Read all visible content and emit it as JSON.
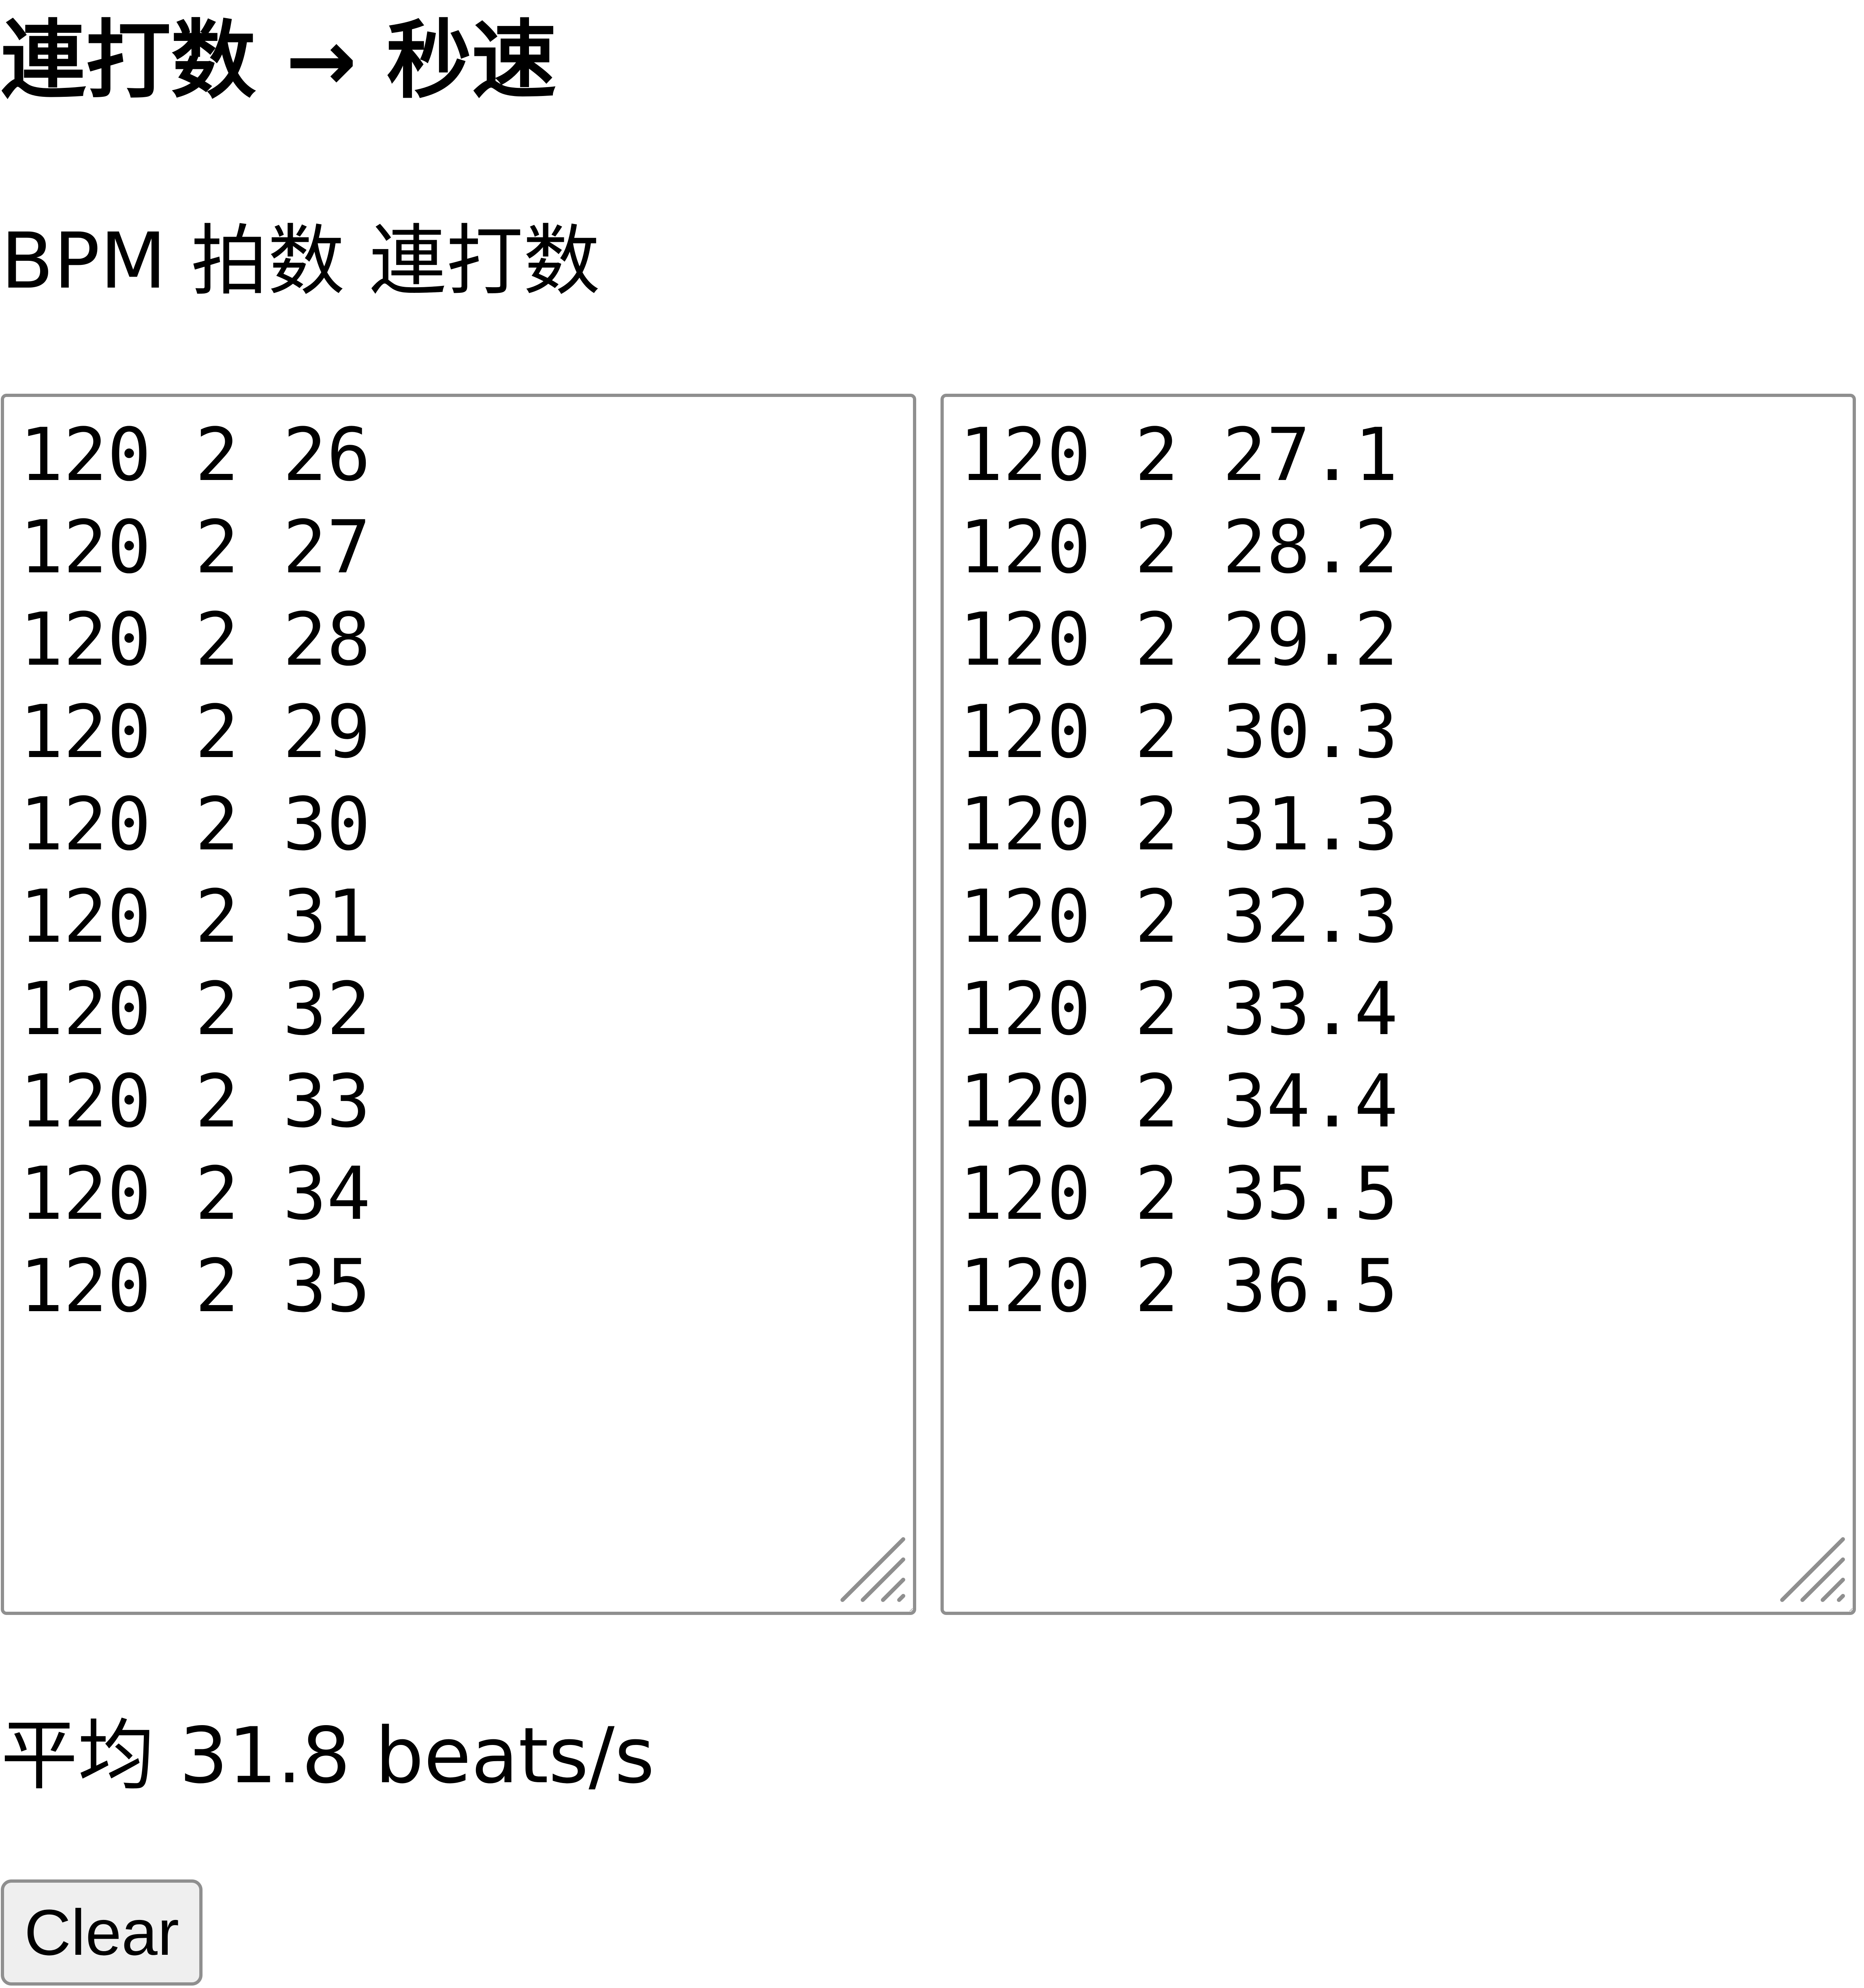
{
  "page": {
    "title": "連打数 → 秒速",
    "columns_label": "BPM 拍数 連打数"
  },
  "input_area": {
    "value": "120 2 26\n120 2 27\n120 2 28\n120 2 29\n120 2 30\n120 2 31\n120 2 32\n120 2 33\n120 2 34\n120 2 35"
  },
  "output_area": {
    "value": "120 2 27.1\n120 2 28.2\n120 2 29.2\n120 2 30.3\n120 2 31.3\n120 2 32.3\n120 2 33.4\n120 2 34.4\n120 2 35.5\n120 2 36.5"
  },
  "summary": {
    "average_text": "平均 31.8 beats/s"
  },
  "controls": {
    "clear_label": "Clear"
  },
  "colors": {
    "border": "#8f8f8f",
    "button_background": "#efefef",
    "text": "#000000",
    "background": "#ffffff"
  },
  "icons": {
    "resize_grip": "resize-grip-icon"
  }
}
